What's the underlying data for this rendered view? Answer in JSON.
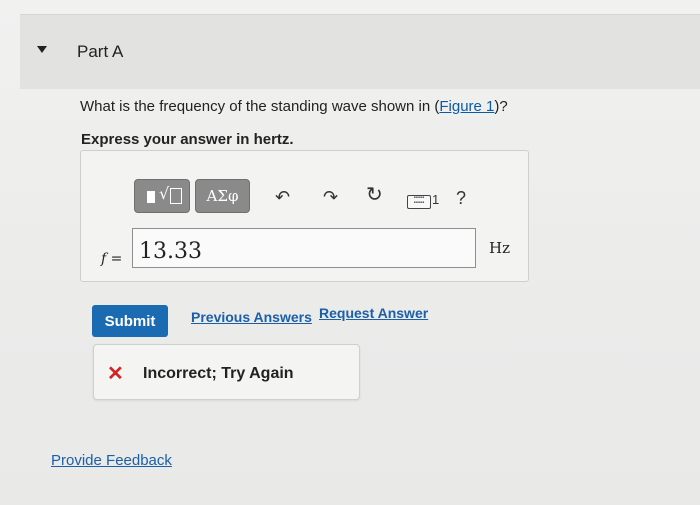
{
  "part": {
    "title": "Part A",
    "caret_icon": "caret-down-icon"
  },
  "question": {
    "text": "What is the frequency of the standing wave shown in (",
    "link_text": "Figure 1",
    "suffix": ")?",
    "instruction": "Express your answer in hertz."
  },
  "toolbar": {
    "math_template_icon": "radical-template-icon",
    "greek_label": "ΑΣφ",
    "undo_icon": "undo-arrow-icon",
    "redo_icon": "redo-arrow-icon",
    "reset_icon": "reset-icon",
    "keyboard_icon": "keyboard-icon",
    "keyboard_digit": "1",
    "help_label": "?"
  },
  "answer": {
    "variable": "f",
    "equals": "=",
    "value": "13.33",
    "units": "Hz"
  },
  "actions": {
    "submit_label": "Submit",
    "previous_answers_label": "Previous Answers",
    "request_answer_label": "Request Answer"
  },
  "feedback": {
    "icon": "close-x-icon",
    "icon_color": "#d22424",
    "message": "Incorrect; Try Again"
  },
  "footer": {
    "provide_feedback_label": "Provide Feedback"
  },
  "colors": {
    "accent": "#1b6bb2",
    "link": "#1b5fa8"
  }
}
